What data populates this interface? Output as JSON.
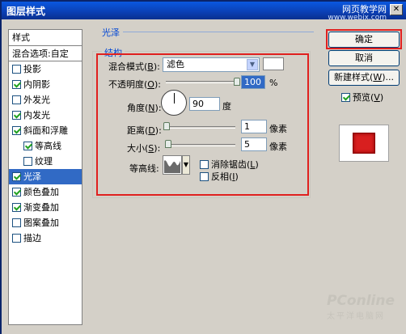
{
  "window": {
    "title": "图层样式",
    "close_glyph": "✕"
  },
  "watermark": {
    "site": "网页教学网",
    "url": "www.webjx.com"
  },
  "sidebar": {
    "header": "样式",
    "blend_options": "混合选项:自定",
    "items": [
      {
        "label": "投影",
        "checked": false,
        "indent": false,
        "selected": false
      },
      {
        "label": "内阴影",
        "checked": true,
        "indent": false,
        "selected": false
      },
      {
        "label": "外发光",
        "checked": false,
        "indent": false,
        "selected": false
      },
      {
        "label": "内发光",
        "checked": true,
        "indent": false,
        "selected": false
      },
      {
        "label": "斜面和浮雕",
        "checked": true,
        "indent": false,
        "selected": false
      },
      {
        "label": "等高线",
        "checked": true,
        "indent": true,
        "selected": false
      },
      {
        "label": "纹理",
        "checked": false,
        "indent": true,
        "selected": false
      },
      {
        "label": "光泽",
        "checked": true,
        "indent": false,
        "selected": true
      },
      {
        "label": "颜色叠加",
        "checked": true,
        "indent": false,
        "selected": false
      },
      {
        "label": "渐变叠加",
        "checked": true,
        "indent": false,
        "selected": false
      },
      {
        "label": "图案叠加",
        "checked": false,
        "indent": false,
        "selected": false
      },
      {
        "label": "描边",
        "checked": false,
        "indent": false,
        "selected": false
      }
    ]
  },
  "satin": {
    "section_title": "光泽",
    "group_title": "结构",
    "blend_mode_label": "混合模式(B):",
    "blend_mode_value": "滤色",
    "blend_color": "#ffffff",
    "opacity_label": "不透明度(O):",
    "opacity_value": "100",
    "opacity_unit": "%",
    "opacity_fraction": 1.0,
    "angle_label": "角度(N):",
    "angle_value": "90",
    "angle_unit": "度",
    "distance_label": "距离(D):",
    "distance_value": "1",
    "distance_unit": "像素",
    "size_label": "大小(S):",
    "size_value": "5",
    "size_unit": "像素",
    "contour_label": "等高线:",
    "antialias_label": "消除锯齿(L)",
    "antialias_checked": false,
    "invert_label": "反相(I)",
    "invert_checked": false
  },
  "buttons": {
    "ok": "确定",
    "cancel": "取消",
    "new_style": "新建样式(W)...",
    "preview_label": "预览(V)",
    "preview_checked": true
  },
  "colors": {
    "highlight_red": "#e0201f",
    "selection_blue": "#316ac5",
    "preview_red": "#d81f1f"
  },
  "logo": {
    "brand": "PConline",
    "tagline": "太平洋电脑网"
  }
}
